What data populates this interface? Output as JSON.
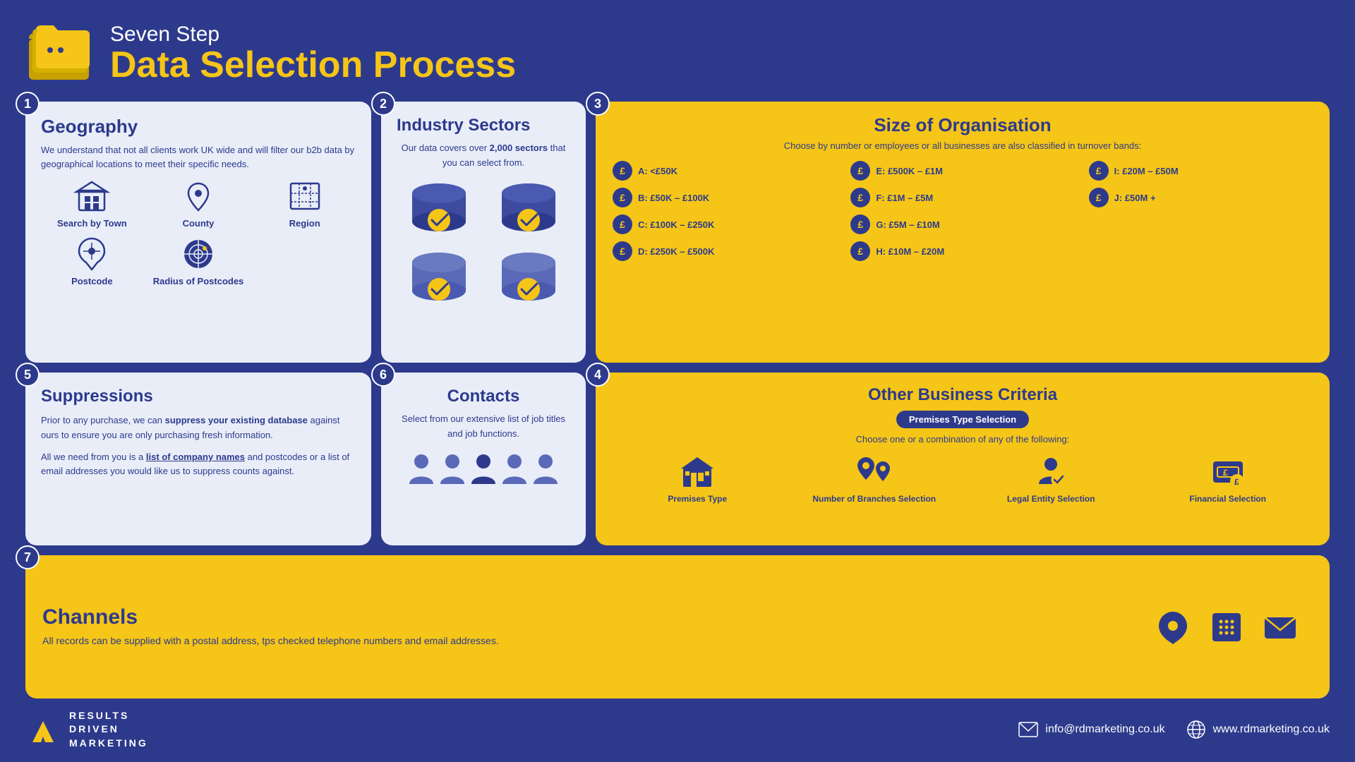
{
  "header": {
    "subtitle": "Seven Step",
    "title": "Data Selection Process"
  },
  "steps": {
    "step1": {
      "number": "1",
      "title": "Geography",
      "description": "We understand that not all clients work UK wide and will filter our b2b data by geographical locations to meet their specific needs.",
      "geo_items": [
        {
          "label": "Search by Town",
          "icon": "building"
        },
        {
          "label": "County",
          "icon": "location"
        },
        {
          "label": "Region",
          "icon": "map"
        },
        {
          "label": "Postcode",
          "icon": "pin"
        },
        {
          "label": "Radius of Postcodes",
          "icon": "radar"
        }
      ]
    },
    "step2": {
      "number": "2",
      "title": "Industry Sectors",
      "description": "Our data covers over 2,000 sectors that you can select from.",
      "highlight": "2,000"
    },
    "step3": {
      "number": "3",
      "title": "Size of Organisation",
      "subtitle": "Choose by number or employees or all businesses are also classified in turnover bands:",
      "bands": [
        {
          "label": "A: <£50K"
        },
        {
          "label": "E: £500K – £1M"
        },
        {
          "label": "I: £20M – £50M"
        },
        {
          "label": "B: £50K – £100K"
        },
        {
          "label": "F: £1M – £5M"
        },
        {
          "label": "J: £50M +"
        },
        {
          "label": "C: £100K – £250K"
        },
        {
          "label": "G: £5M – £10M"
        },
        {
          "label": ""
        },
        {
          "label": "D: £250K – £500K"
        },
        {
          "label": "H: £10M – £20M"
        },
        {
          "label": ""
        }
      ]
    },
    "step4": {
      "number": "4",
      "title": "Other Business Criteria",
      "badge": "Premises Type Selection",
      "subtitle": "Choose one or a combination of any of the following:",
      "criteria": [
        {
          "label": "Premises Type"
        },
        {
          "label": "Number of Branches Selection"
        },
        {
          "label": "Legal Entity Selection"
        },
        {
          "label": "Financial Selection"
        }
      ]
    },
    "step5": {
      "number": "5",
      "title": "Suppressions",
      "text1": "Prior to any purchase, we can ",
      "highlight1": "suppress your existing database",
      "text2": " against ours to ensure you are only purchasing fresh information.",
      "text3": "All we need from you is a ",
      "highlight2": "list of company names",
      "text4": " and postcodes or a list of email addresses you would like us to suppress counts against."
    },
    "step6": {
      "number": "6",
      "title": "Contacts",
      "description": "Select from our extensive list of job titles and job functions."
    },
    "step7": {
      "number": "7",
      "title": "Channels",
      "description": "All records can be supplied with a postal address, tps checked telephone numbers and email addresses."
    }
  },
  "footer": {
    "logo_lines": [
      "RESULTS",
      "DRIVEN",
      "MARKETING"
    ],
    "email": "info@rdmarketing.co.uk",
    "website": "www.rdmarketing.co.uk"
  }
}
